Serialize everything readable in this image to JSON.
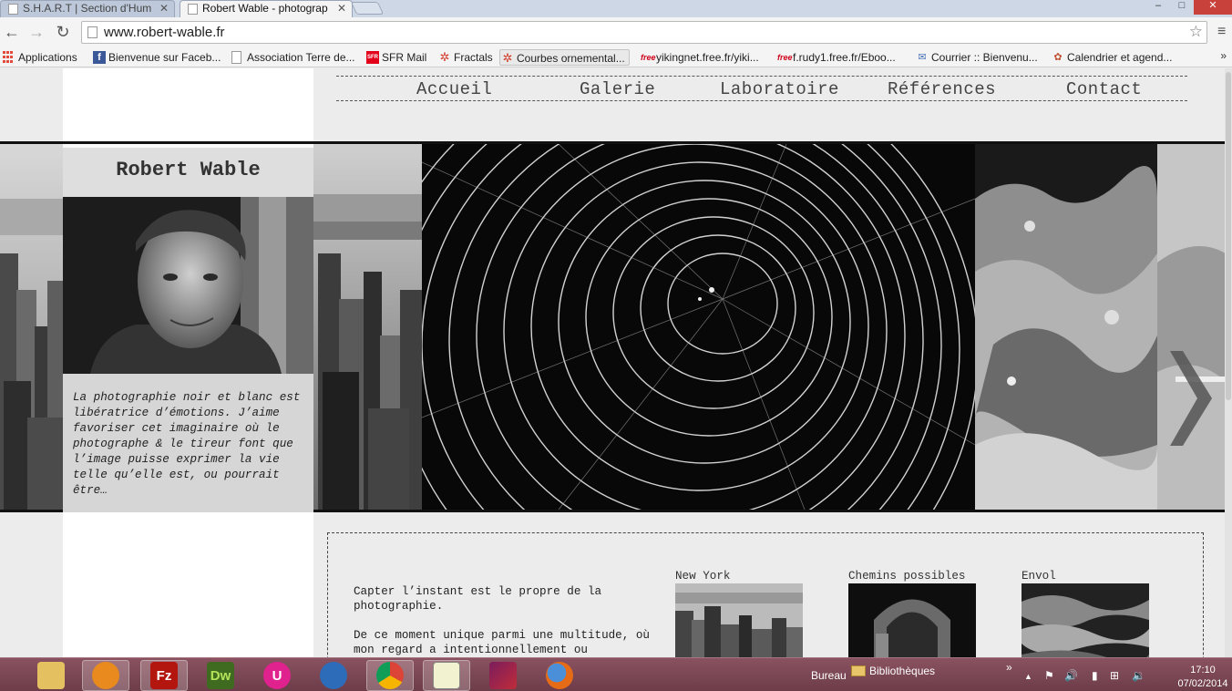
{
  "browser": {
    "tabs": [
      {
        "title": "S.H.A.R.T | Section d'Hum",
        "active": false
      },
      {
        "title": "Robert Wable - photograp",
        "active": true
      }
    ],
    "url": "www.robert-wable.fr",
    "window_controls": {
      "minimize": "–",
      "maximize": "□",
      "close": "✕"
    },
    "bookmarks": [
      {
        "label": "Applications",
        "icon": "apps-grid-icon"
      },
      {
        "label": "Bienvenue sur Faceb...",
        "icon": "facebook-icon"
      },
      {
        "label": "Association Terre de...",
        "icon": "page-icon"
      },
      {
        "label": "SFR Mail",
        "icon": "sfr-icon"
      },
      {
        "label": "Fractals",
        "icon": "fractal-icon"
      },
      {
        "label": "Courbes ornemental...",
        "icon": "fractal-icon"
      },
      {
        "label": "yikingnet.free.fr/yiki...",
        "icon": "free-icon"
      },
      {
        "label": "f.rudy1.free.fr/Eboo...",
        "icon": "free-icon"
      },
      {
        "label": "Courrier :: Bienvenu...",
        "icon": "mail-icon"
      },
      {
        "label": "Calendrier et agend...",
        "icon": "calendar-icon"
      }
    ],
    "bookmark_icon_glyphs": {
      "fb": "f",
      "sfr": "SFR",
      "fractal": "✲",
      "free": "free",
      "mail": "✉",
      "cal": "✿"
    },
    "more_bookmarks": "»"
  },
  "site": {
    "nav": [
      "Accueil",
      "Galerie",
      "Laboratoire",
      "Références",
      "Contact"
    ],
    "title": "Robert Wable",
    "quote": "La photographie noir et blanc est libératrice d’émotions. J’aime favoriser cet imaginaire où le photographe & le tireur font que l’image puisse exprimer la vie telle qu’elle est, ou pourrait être…",
    "intro": [
      "Capter l’instant est le propre de la photographie.",
      "De ce moment unique parmi une multitude, où mon regard a intentionnellement ou"
    ],
    "galleries": [
      {
        "title": "New York"
      },
      {
        "title": "Chemins possibles"
      },
      {
        "title": "Envol"
      }
    ]
  },
  "taskbar": {
    "apps": [
      {
        "name": "file-explorer",
        "label": ""
      },
      {
        "name": "media-player",
        "label": ""
      },
      {
        "name": "filezilla",
        "label": "Fz"
      },
      {
        "name": "dreamweaver",
        "label": "Dw"
      },
      {
        "name": "uc-app",
        "label": "U"
      },
      {
        "name": "thunderbird",
        "label": ""
      },
      {
        "name": "chrome",
        "label": ""
      },
      {
        "name": "notepad-plus",
        "label": ""
      },
      {
        "name": "ribbon-app",
        "label": ""
      },
      {
        "name": "firefox",
        "label": ""
      }
    ],
    "desktop_label": "Bureau",
    "libraries_label": "Bibliothèques",
    "chevron": "»",
    "tray": {
      "up": "▲",
      "flag": "⚑",
      "speaker": "🔊",
      "battery": "▮",
      "network": "⊞",
      "volume": "🔉"
    },
    "time": "17:10",
    "date": "07/02/2014"
  },
  "colors": {
    "taskbar": "#7a4753",
    "accent_red": "#c8413a"
  }
}
